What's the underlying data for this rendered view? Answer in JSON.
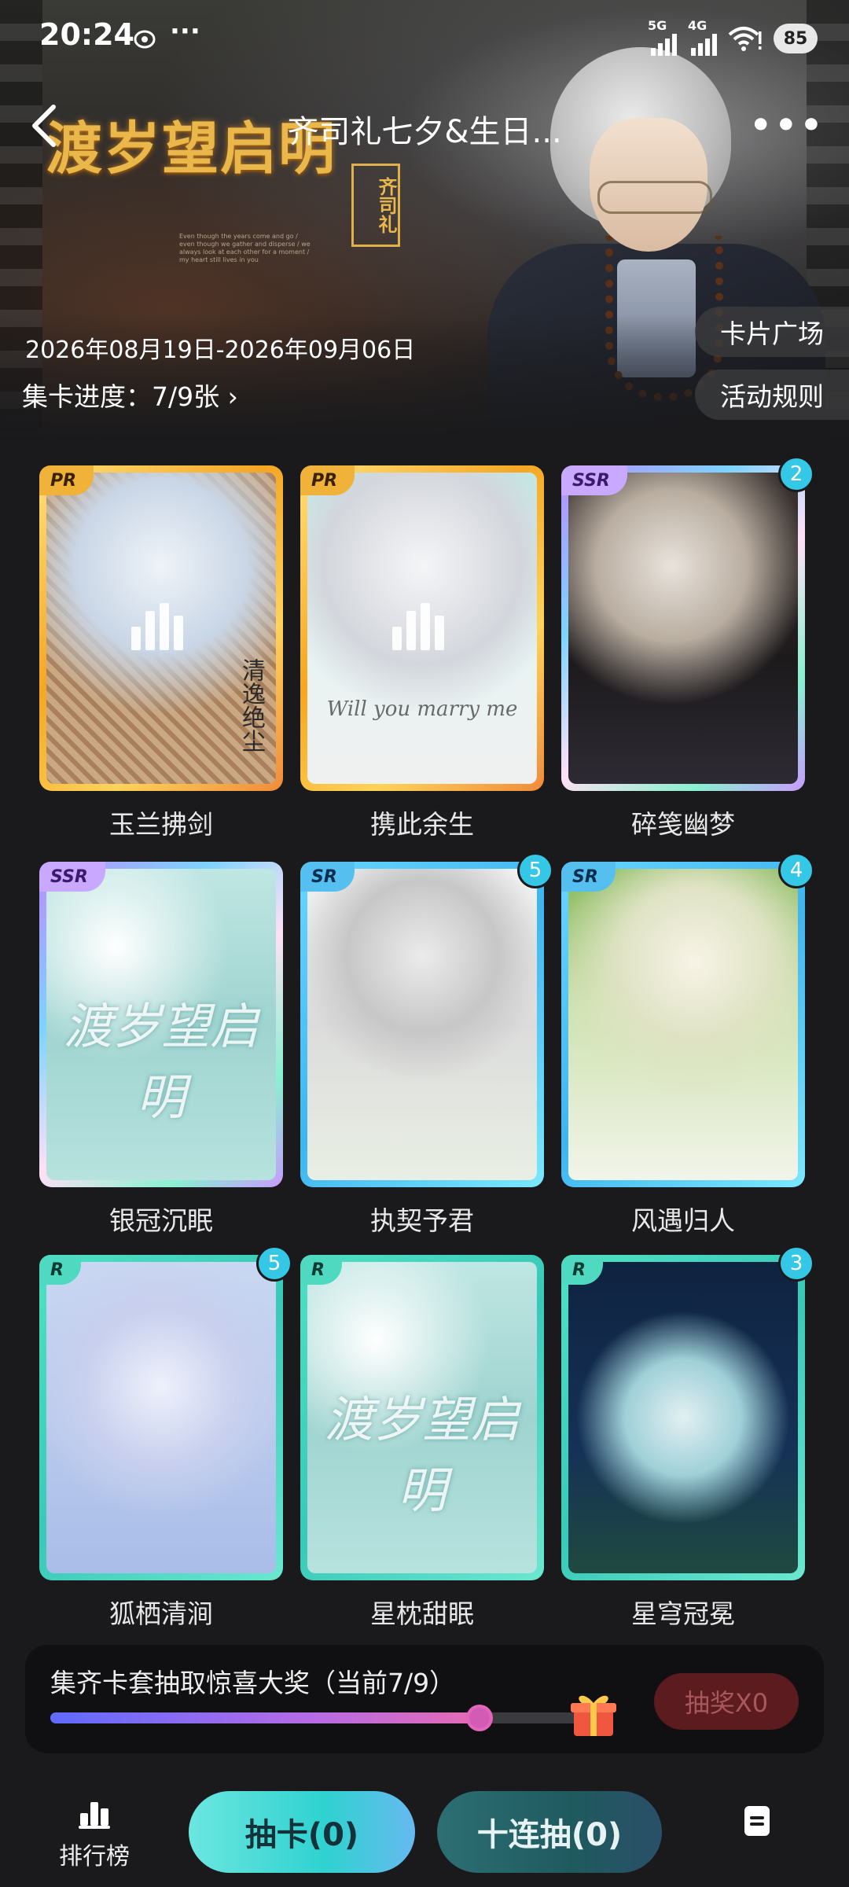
{
  "status_bar": {
    "time": "20:24",
    "more": "···",
    "signal_1_label": "5G",
    "signal_2_label": "4G",
    "wifi_label": "!",
    "battery": "85"
  },
  "nav": {
    "title": "齐司礼七夕&生日...",
    "more": "•••"
  },
  "banner": {
    "logo_text": "渡岁望启明",
    "seal_text": "齐司礼",
    "caption": "Even though the years come and go / even though we gather and disperse / we always look at each other for a moment / my heart still lives in you",
    "date_range": "2026年08月19日-2026年09月06日",
    "progress_label": "集卡进度：7/9张 ›",
    "card_plaza": "卡片广场",
    "event_rules": "活动规则"
  },
  "cards": [
    {
      "name": "玉兰拂剑",
      "rarity": "PR",
      "count": "",
      "art_text": "清逸绝尘"
    },
    {
      "name": "携此余生",
      "rarity": "PR",
      "count": "",
      "art_text": "Will you marry me"
    },
    {
      "name": "碎笺幽梦",
      "rarity": "SSR",
      "count": "2",
      "art_text": ""
    },
    {
      "name": "银冠沉眠",
      "rarity": "SSR",
      "count": "",
      "art_text": "渡岁望启明"
    },
    {
      "name": "执契予君",
      "rarity": "SR",
      "count": "5",
      "art_text": ""
    },
    {
      "name": "风遇归人",
      "rarity": "SR",
      "count": "4",
      "art_text": ""
    },
    {
      "name": "狐栖清涧",
      "rarity": "R",
      "count": "5",
      "art_text": ""
    },
    {
      "name": "星枕甜眠",
      "rarity": "R",
      "count": "",
      "art_text": "渡岁望启明"
    },
    {
      "name": "星穹冠冕",
      "rarity": "R",
      "count": "3",
      "art_text": ""
    }
  ],
  "reward": {
    "title": "集齐卡套抽取惊喜大奖（当前7/9）",
    "progress": 0.78,
    "draw_button": "抽奖X0"
  },
  "bottom_bar": {
    "rank_label": "排行榜",
    "pull_one": "抽卡(0)",
    "pull_ten": "十连抽(0)"
  },
  "colors": {
    "accent_cyan": "#2fd2d0",
    "badge": "#35c7e6",
    "pr_frame": "#f5a623",
    "ssr_frame": "#b98cff",
    "sr_frame": "#3fb5f0",
    "r_frame": "#39c9b8"
  },
  "icons": [
    "back-icon",
    "more-icon",
    "gift-icon",
    "rank-icon",
    "document-icon",
    "wifi-icon",
    "signal-icon",
    "battery-icon"
  ]
}
